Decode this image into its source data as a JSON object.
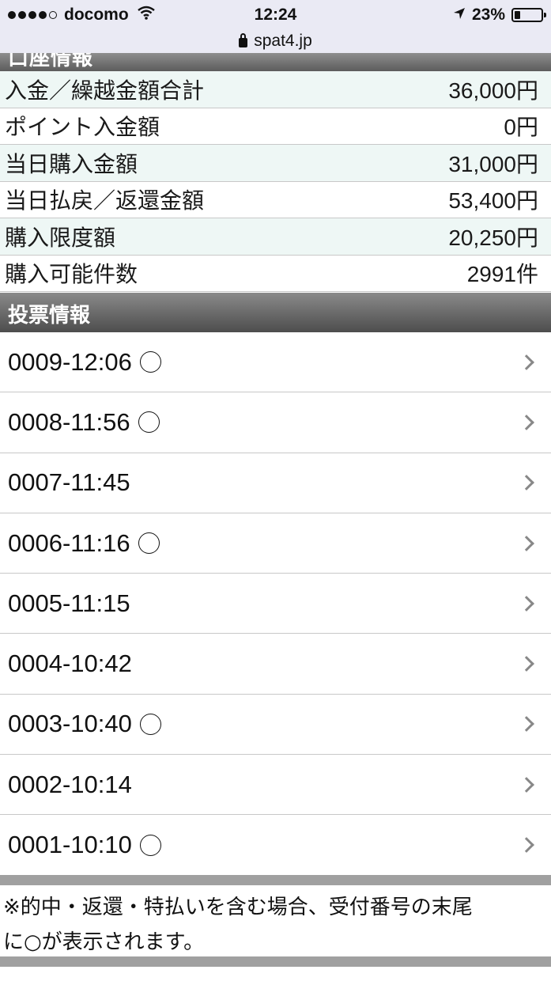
{
  "status_bar": {
    "carrier": "docomo",
    "time": "12:24",
    "battery_percent": "23%",
    "battery_level": 0.23,
    "signal_bars": 4
  },
  "url_bar": {
    "url": "spat4.jp"
  },
  "cut_header": {
    "title": "口座情報"
  },
  "balance": [
    {
      "label": "入金／繰越金額合計",
      "value": "36,000円"
    },
    {
      "label": "ポイント入金額",
      "value": "0円"
    },
    {
      "label": "当日購入金額",
      "value": "31,000円"
    },
    {
      "label": "当日払戻／返還金額",
      "value": "53,400円"
    },
    {
      "label": "購入限度額",
      "value": "20,250円"
    },
    {
      "label": "購入可能件数",
      "value": "2991件"
    }
  ],
  "section": {
    "title": "投票情報"
  },
  "tickets": [
    {
      "id": "0009-12:06",
      "hit": true
    },
    {
      "id": "0008-11:56",
      "hit": true
    },
    {
      "id": "0007-11:45",
      "hit": false
    },
    {
      "id": "0006-11:16",
      "hit": true
    },
    {
      "id": "0005-11:15",
      "hit": false
    },
    {
      "id": "0004-10:42",
      "hit": false
    },
    {
      "id": "0003-10:40",
      "hit": true
    },
    {
      "id": "0002-10:14",
      "hit": false
    },
    {
      "id": "0001-10:10",
      "hit": true
    }
  ],
  "note": {
    "line1": "※的中・返還・特払いを含む場合、受付番号の末尾",
    "line2": "に○が表示されます。"
  }
}
